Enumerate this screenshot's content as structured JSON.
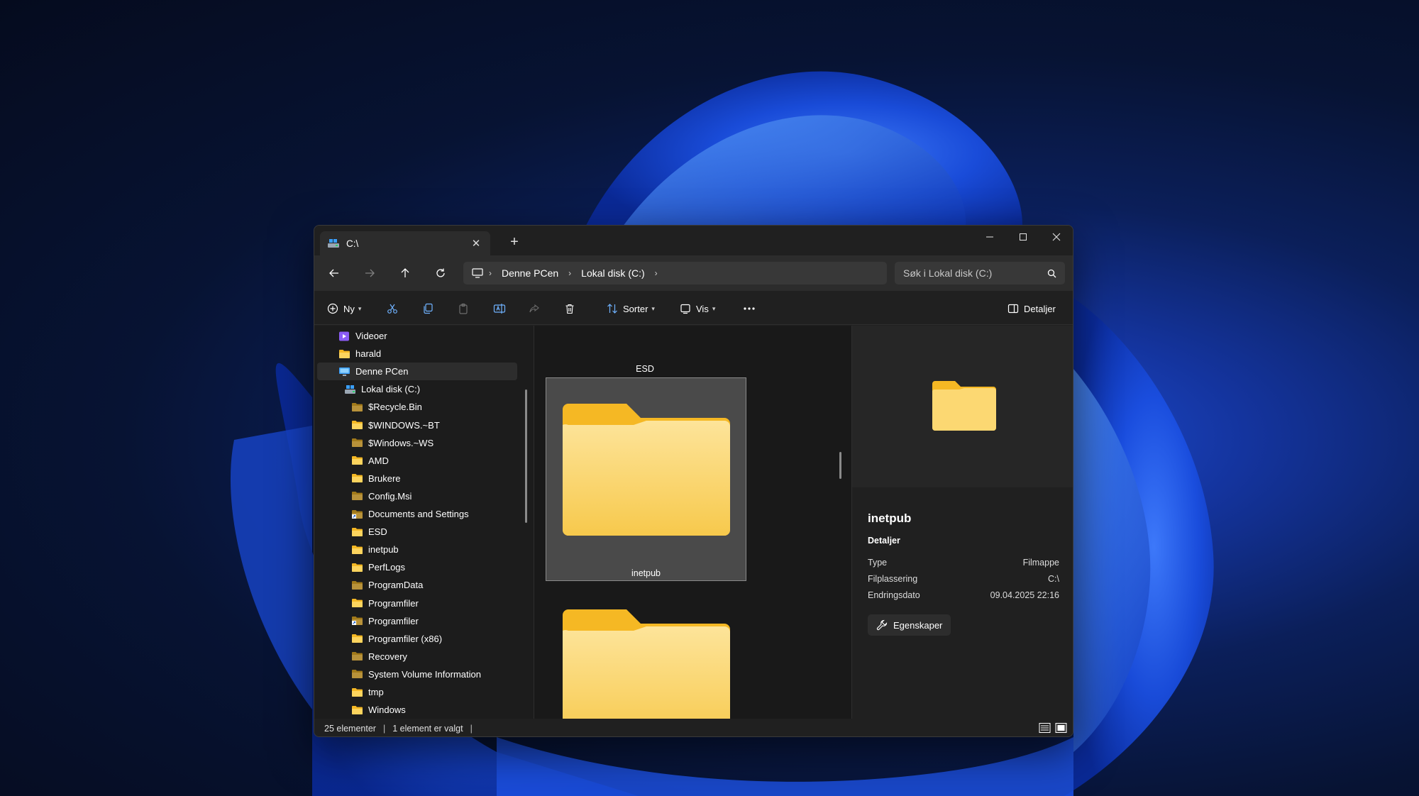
{
  "colors": {
    "folder_back": "#f5b824",
    "folder_front": "#fbd66a",
    "window_bg": "#202020",
    "accent_blue": "#1f4fd8"
  },
  "window": {
    "tab_title": "C:\\",
    "tab_icon": "drive-icon",
    "controls": [
      "minimize-icon",
      "maximize-icon",
      "close-icon"
    ]
  },
  "address": {
    "crumbs": [
      "Denne PCen",
      "Lokal disk (C:)"
    ],
    "search_placeholder": "Søk i Lokal disk (C:)"
  },
  "toolbar": {
    "new_label": "Ny",
    "sort_label": "Sorter",
    "view_label": "Vis",
    "details_label": "Detaljer",
    "icons": [
      "cut-icon",
      "copy-icon",
      "paste-icon",
      "rename-icon",
      "share-icon",
      "delete-icon",
      "more-icon"
    ]
  },
  "sidebar": {
    "items": [
      {
        "label": "Videoer",
        "icon": "videos-icon",
        "selected": false
      },
      {
        "label": "harald",
        "icon": "folder-icon",
        "selected": false
      },
      {
        "label": "Denne PCen",
        "icon": "pc-icon",
        "selected": true
      },
      {
        "label": "Lokal disk (C:)",
        "icon": "drive-icon",
        "selected": false
      },
      {
        "label": "$Recycle.Bin",
        "icon": "folder-dim-icon"
      },
      {
        "label": "$WINDOWS.~BT",
        "icon": "folder-icon"
      },
      {
        "label": "$Windows.~WS",
        "icon": "folder-dim-icon"
      },
      {
        "label": "AMD",
        "icon": "folder-icon"
      },
      {
        "label": "Brukere",
        "icon": "folder-icon"
      },
      {
        "label": "Config.Msi",
        "icon": "folder-dim-icon"
      },
      {
        "label": "Documents and Settings",
        "icon": "folder-link-icon"
      },
      {
        "label": "ESD",
        "icon": "folder-icon"
      },
      {
        "label": "inetpub",
        "icon": "folder-icon"
      },
      {
        "label": "PerfLogs",
        "icon": "folder-icon"
      },
      {
        "label": "ProgramData",
        "icon": "folder-dim-icon"
      },
      {
        "label": "Programfiler",
        "icon": "folder-icon"
      },
      {
        "label": "Programfiler",
        "icon": "folder-link-icon"
      },
      {
        "label": "Programfiler (x86)",
        "icon": "folder-icon"
      },
      {
        "label": "Recovery",
        "icon": "folder-dim-icon"
      },
      {
        "label": "System Volume Information",
        "icon": "folder-dim-icon"
      },
      {
        "label": "tmp",
        "icon": "folder-icon"
      },
      {
        "label": "Windows",
        "icon": "folder-icon"
      }
    ]
  },
  "content": {
    "top_label": "ESD",
    "selected_label": "inetpub"
  },
  "details": {
    "name": "inetpub",
    "section": "Detaljer",
    "rows": [
      {
        "key": "Type",
        "value": "Filmappe"
      },
      {
        "key": "Filplassering",
        "value": "C:\\"
      },
      {
        "key": "Endringsdato",
        "value": "09.04.2025 22:16"
      }
    ],
    "properties_label": "Egenskaper"
  },
  "status": {
    "count": "25 elementer",
    "selection": "1 element er valgt"
  }
}
